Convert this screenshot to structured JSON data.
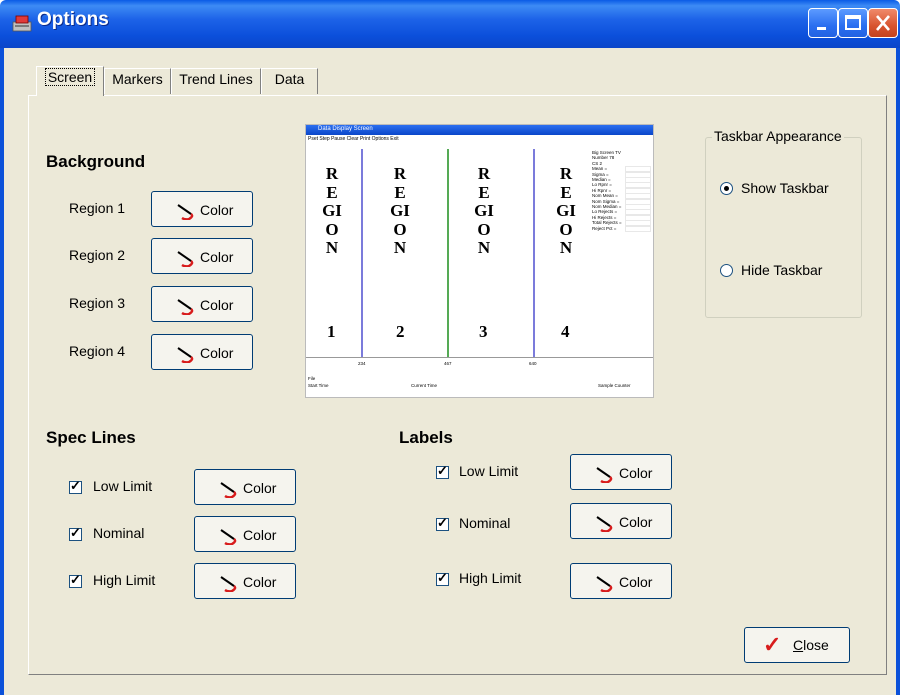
{
  "window": {
    "title": "Options",
    "icon": "app-icon"
  },
  "tabs": [
    {
      "label": "Screen",
      "selected": true
    },
    {
      "label": "Markers"
    },
    {
      "label": "Trend Lines"
    },
    {
      "label": "Data"
    }
  ],
  "background": {
    "heading": "Background",
    "regions": [
      {
        "label": "Region 1",
        "button": "Color"
      },
      {
        "label": "Region 2",
        "button": "Color"
      },
      {
        "label": "Region 3",
        "button": "Color"
      },
      {
        "label": "Region 4",
        "button": "Color"
      }
    ]
  },
  "spec_lines": {
    "heading": "Spec Lines",
    "items": [
      {
        "label": "Low Limit",
        "checked": true,
        "button": "Color"
      },
      {
        "label": "Nominal",
        "checked": true,
        "button": "Color"
      },
      {
        "label": "High Limit",
        "checked": true,
        "button": "Color"
      }
    ]
  },
  "labels": {
    "heading": "Labels",
    "items": [
      {
        "label": "Low Limit",
        "checked": true,
        "button": "Color"
      },
      {
        "label": "Nominal",
        "checked": true,
        "button": "Color"
      },
      {
        "label": "High Limit",
        "checked": true,
        "button": "Color"
      }
    ]
  },
  "taskbar": {
    "legend": "Taskbar Appearance",
    "show": "Show Taskbar",
    "hide": "Hide Taskbar",
    "selected": "show"
  },
  "preview": {
    "title": "Data Display Screen",
    "menu": "Pset   Step   Pause   Clear   Print   Options   Exit",
    "regions": [
      "REGION",
      "REGION",
      "REGION",
      "REGION"
    ],
    "region_numbers": [
      "1",
      "2",
      "3",
      "4"
    ],
    "line_colors": [
      "#7b7bdb",
      "#55aa55",
      "#7b7bdb"
    ],
    "side_text": [
      "Big Screen TV",
      "Number 78",
      "CS 2",
      "Mean =",
      "Sigma =",
      "Median =",
      "Lo Rpnr =",
      "Hi Rpnr =",
      "Nom Mean =",
      "Nom Sigma =",
      "Nom Median =",
      "Lo Rejects =",
      "Hi Rejects =",
      "Total Rejects =",
      "Reject Pct ="
    ],
    "axis_ticks": [
      "234",
      "467",
      "640"
    ],
    "bottom_left": "File",
    "start_time": "Start Time",
    "current_time": "Current Time",
    "sample_counter": "Sample Counter"
  },
  "close_button": {
    "label": "Close"
  }
}
